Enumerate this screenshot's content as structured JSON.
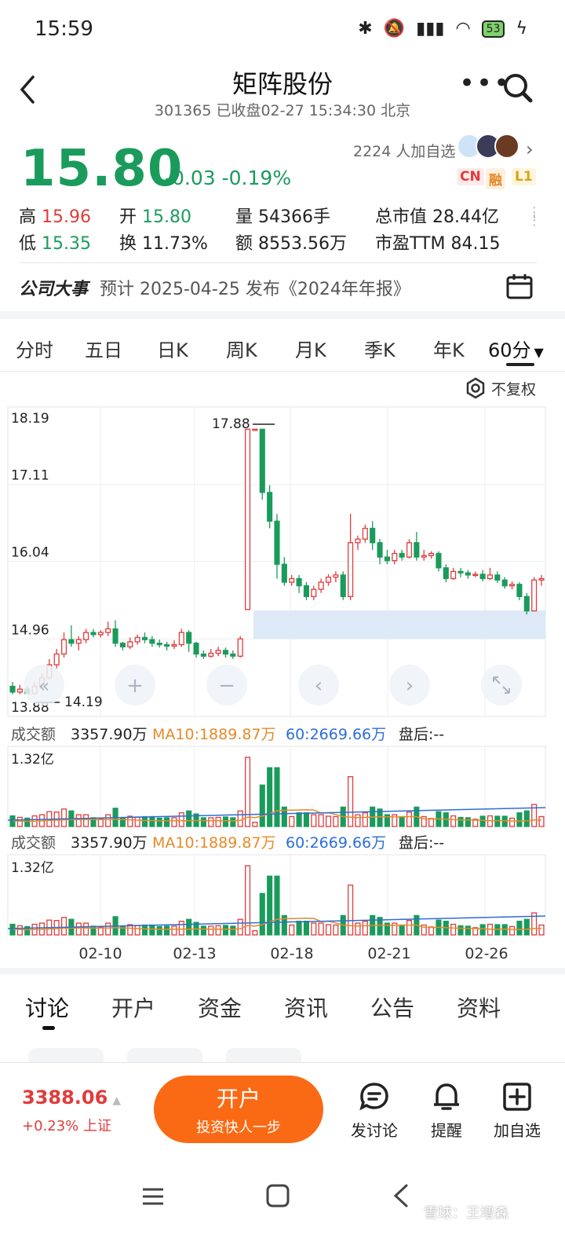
{
  "status_bar": {
    "time": "15:59",
    "battery": "53"
  },
  "header": {
    "title": "矩阵股份",
    "subtitle": "301365 已收盘02-27 15:34:30 北京"
  },
  "quote": {
    "price": "15.80",
    "change": "-0.03 -0.19%",
    "followers": "2224 人加自选",
    "badges": [
      "CN",
      "融",
      "L1"
    ]
  },
  "stats": {
    "high_label": "高",
    "high": "15.96",
    "low_label": "低",
    "low": "15.35",
    "open_label": "开",
    "open": "15.80",
    "turnover_label": "换",
    "turnover": "11.73%",
    "volume_label": "量",
    "volume": "54366手",
    "amount_label": "额",
    "amount": "8553.56万",
    "mktcap_label": "总市值",
    "mktcap": "28.44亿",
    "pe_label": "市盈TTM",
    "pe": "84.15"
  },
  "event": {
    "label": "公司大事",
    "text": "预计 2025-04-25 发布《2024年年报》"
  },
  "period_tabs": [
    "分时",
    "五日",
    "日K",
    "周K",
    "月K",
    "季K",
    "年K",
    "60分"
  ],
  "active_period": "60分",
  "adjust_label": "不复权",
  "chart_data": {
    "type": "candlestick",
    "interval": "60分",
    "y_ticks": [
      "18.19",
      "17.11",
      "16.04",
      "14.96",
      "13.88"
    ],
    "ylim": [
      13.88,
      18.19
    ],
    "x_ticks": [
      "02-10",
      "02-13",
      "02-18",
      "02-21",
      "02-26"
    ],
    "max_label": "17.88",
    "min_label": "14.19",
    "up_color": "#e03c3c",
    "down_color": "#1a9b5c",
    "candles": [
      [
        14.3,
        14.22,
        14.36,
        14.19
      ],
      [
        14.22,
        14.26,
        14.32,
        14.19
      ],
      [
        14.26,
        14.2,
        14.3,
        14.19
      ],
      [
        14.2,
        14.3,
        14.36,
        14.19
      ],
      [
        14.3,
        14.42,
        14.48,
        14.28
      ],
      [
        14.42,
        14.6,
        14.68,
        14.4
      ],
      [
        14.6,
        14.75,
        14.82,
        14.55
      ],
      [
        14.75,
        14.95,
        15.05,
        14.7
      ],
      [
        14.95,
        14.9,
        15.15,
        14.85
      ],
      [
        14.9,
        14.95,
        15.0,
        14.8
      ],
      [
        14.95,
        15.05,
        15.1,
        14.9
      ],
      [
        15.05,
        15.02,
        15.1,
        14.98
      ],
      [
        15.02,
        15.05,
        15.08,
        14.98
      ],
      [
        15.05,
        15.1,
        15.2,
        15.0
      ],
      [
        15.1,
        14.9,
        15.22,
        14.85
      ],
      [
        14.9,
        14.85,
        14.92,
        14.8
      ],
      [
        14.85,
        14.92,
        14.98,
        14.82
      ],
      [
        14.92,
        14.98,
        15.02,
        14.88
      ],
      [
        14.98,
        14.95,
        15.05,
        14.9
      ],
      [
        14.95,
        14.9,
        15.0,
        14.85
      ],
      [
        14.9,
        14.88,
        14.95,
        14.84
      ],
      [
        14.88,
        14.86,
        14.92,
        14.8
      ],
      [
        14.86,
        14.88,
        14.94,
        14.82
      ],
      [
        14.88,
        15.05,
        15.1,
        14.85
      ],
      [
        15.05,
        14.9,
        15.08,
        14.78
      ],
      [
        14.9,
        14.75,
        14.92,
        14.7
      ],
      [
        14.75,
        14.72,
        14.8,
        14.68
      ],
      [
        14.72,
        14.76,
        14.82,
        14.7
      ],
      [
        14.76,
        14.8,
        14.85,
        14.72
      ],
      [
        14.8,
        14.75,
        14.84,
        14.7
      ],
      [
        14.75,
        14.72,
        14.8,
        14.68
      ],
      [
        14.72,
        14.96,
        15.0,
        14.7
      ],
      [
        15.37,
        17.88,
        17.88,
        15.37
      ],
      [
        17.88,
        17.88,
        17.88,
        17.88
      ],
      [
        17.88,
        17.0,
        17.88,
        16.9
      ],
      [
        17.0,
        16.6,
        17.1,
        16.5
      ],
      [
        16.6,
        16.0,
        16.7,
        15.8
      ],
      [
        16.0,
        15.75,
        16.1,
        15.7
      ],
      [
        15.75,
        15.8,
        15.85,
        15.7
      ],
      [
        15.8,
        15.7,
        15.85,
        15.6
      ],
      [
        15.7,
        15.55,
        15.75,
        15.5
      ],
      [
        15.55,
        15.65,
        15.7,
        15.5
      ],
      [
        15.65,
        15.75,
        15.8,
        15.6
      ],
      [
        15.75,
        15.82,
        15.86,
        15.7
      ],
      [
        15.82,
        15.85,
        15.9,
        15.75
      ],
      [
        15.85,
        15.55,
        15.9,
        15.5
      ],
      [
        15.55,
        16.3,
        16.7,
        15.5
      ],
      [
        16.3,
        16.35,
        16.4,
        16.2
      ],
      [
        16.35,
        16.5,
        16.55,
        16.3
      ],
      [
        16.5,
        16.3,
        16.6,
        16.2
      ],
      [
        16.3,
        16.1,
        16.35,
        16.0
      ],
      [
        16.1,
        16.05,
        16.2,
        16.0
      ],
      [
        16.05,
        16.15,
        16.2,
        16.0
      ],
      [
        16.15,
        16.1,
        16.2,
        16.05
      ],
      [
        16.1,
        16.3,
        16.35,
        16.08
      ],
      [
        16.3,
        16.1,
        16.45,
        16.05
      ],
      [
        16.1,
        16.12,
        16.2,
        16.05
      ],
      [
        16.12,
        16.15,
        16.18,
        16.08
      ],
      [
        16.15,
        15.95,
        16.18,
        15.9
      ],
      [
        15.95,
        15.8,
        16.0,
        15.75
      ],
      [
        15.8,
        15.9,
        15.95,
        15.78
      ],
      [
        15.9,
        15.88,
        15.95,
        15.82
      ],
      [
        15.88,
        15.85,
        15.92,
        15.8
      ],
      [
        15.85,
        15.86,
        15.9,
        15.82
      ],
      [
        15.86,
        15.8,
        15.92,
        15.76
      ],
      [
        15.8,
        15.85,
        15.95,
        15.78
      ],
      [
        15.85,
        15.78,
        15.9,
        15.74
      ],
      [
        15.78,
        15.7,
        15.82,
        15.66
      ],
      [
        15.7,
        15.72,
        15.76,
        15.65
      ],
      [
        15.72,
        15.55,
        15.75,
        15.5
      ],
      [
        15.55,
        15.35,
        15.6,
        15.3
      ],
      [
        15.35,
        15.78,
        15.82,
        15.35
      ],
      [
        15.78,
        15.8,
        15.85,
        15.7
      ]
    ],
    "volume": {
      "label": "成交额",
      "value": "3357.90万",
      "ma10": "MA10:1889.87万",
      "ma60": "60:2669.66万",
      "after_hours": "盘后:--",
      "max_label": "1.32亿"
    }
  },
  "bottom_tabs": [
    "讨论",
    "开户",
    "资金",
    "资讯",
    "公告",
    "资料"
  ],
  "bottom_bar": {
    "index_value": "3388.06",
    "index_change": "+0.23% 上证",
    "open_account": "开户",
    "open_account_sub": "投资快人一步",
    "actions": [
      "发讨论",
      "提醒",
      "加自选"
    ]
  },
  "watermark": "雪球：王增森"
}
